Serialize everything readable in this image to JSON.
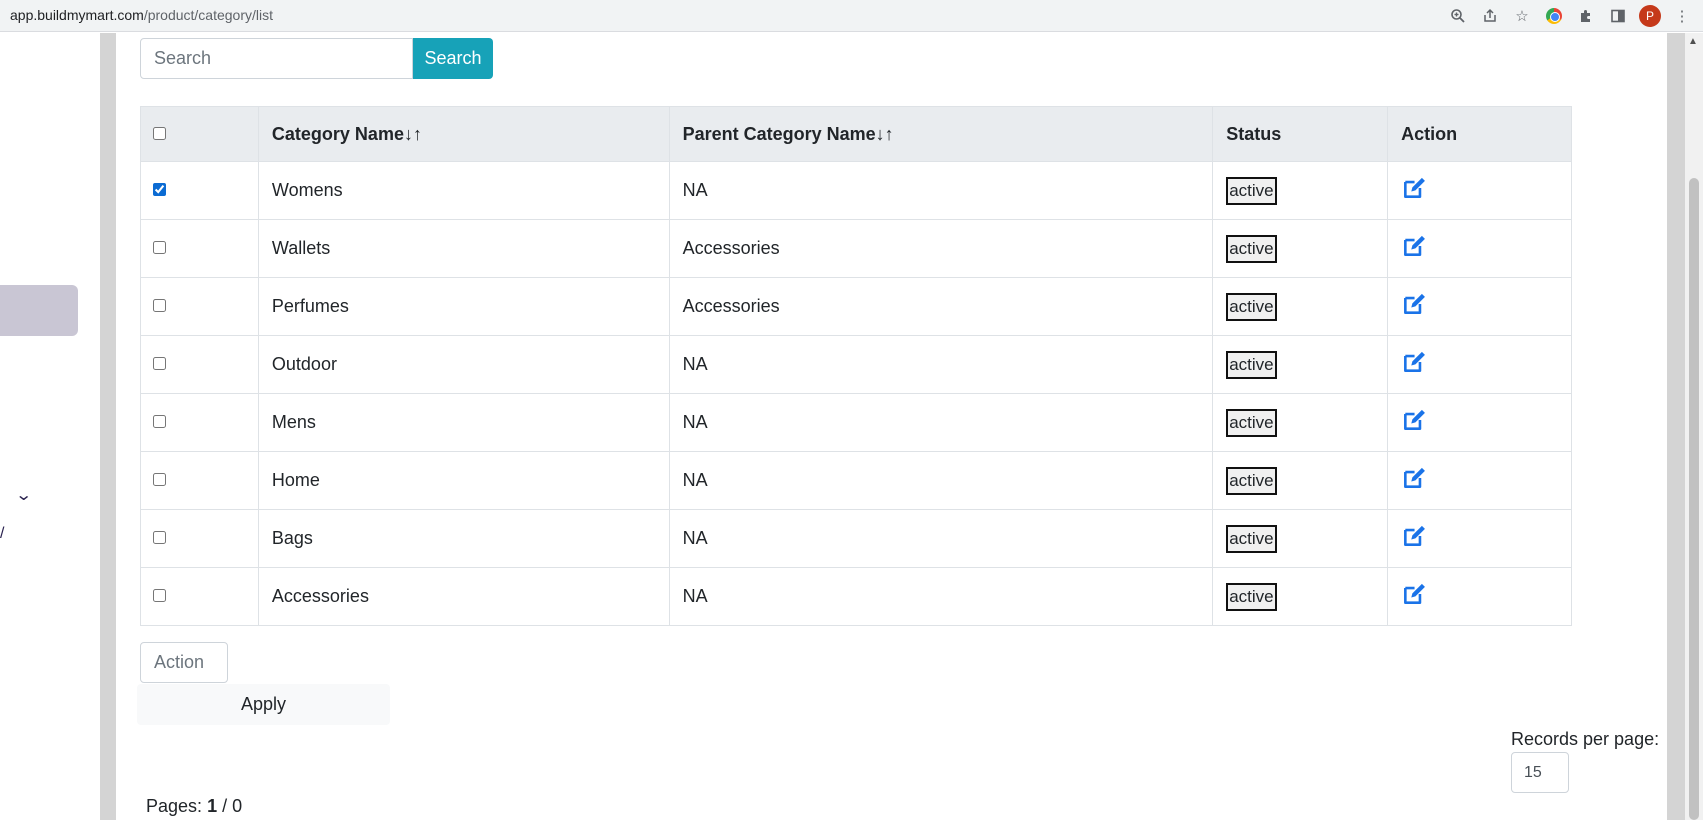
{
  "browser": {
    "url_host": "app.buildmymart.com",
    "url_path": "/product/category/list",
    "avatar_letter": "P"
  },
  "search": {
    "placeholder": "Search",
    "button_label": "Search"
  },
  "table": {
    "headers": {
      "category": "Category Name↓↑",
      "parent": "Parent Category Name↓↑",
      "status": "Status",
      "action": "Action"
    },
    "rows": [
      {
        "checked": true,
        "category": "Womens",
        "parent": "NA",
        "status": "active"
      },
      {
        "checked": false,
        "category": "Wallets",
        "parent": "Accessories",
        "status": "active"
      },
      {
        "checked": false,
        "category": "Perfumes",
        "parent": "Accessories",
        "status": "active"
      },
      {
        "checked": false,
        "category": "Outdoor",
        "parent": "NA",
        "status": "active"
      },
      {
        "checked": false,
        "category": "Mens",
        "parent": "NA",
        "status": "active"
      },
      {
        "checked": false,
        "category": "Home",
        "parent": "NA",
        "status": "active"
      },
      {
        "checked": false,
        "category": "Bags",
        "parent": "NA",
        "status": "active"
      },
      {
        "checked": false,
        "category": "Accessories",
        "parent": "NA",
        "status": "active"
      }
    ]
  },
  "bulk": {
    "action_label": "Action",
    "apply_label": "Apply"
  },
  "pagination": {
    "records_label": "Records per page:",
    "records_value": "15",
    "pages_label": "Pages:",
    "current": "1",
    "separator": " / 0"
  },
  "colors": {
    "accent": "#17a2b8",
    "edit_icon": "#1a73e8",
    "header_bg": "#e9ecef"
  }
}
